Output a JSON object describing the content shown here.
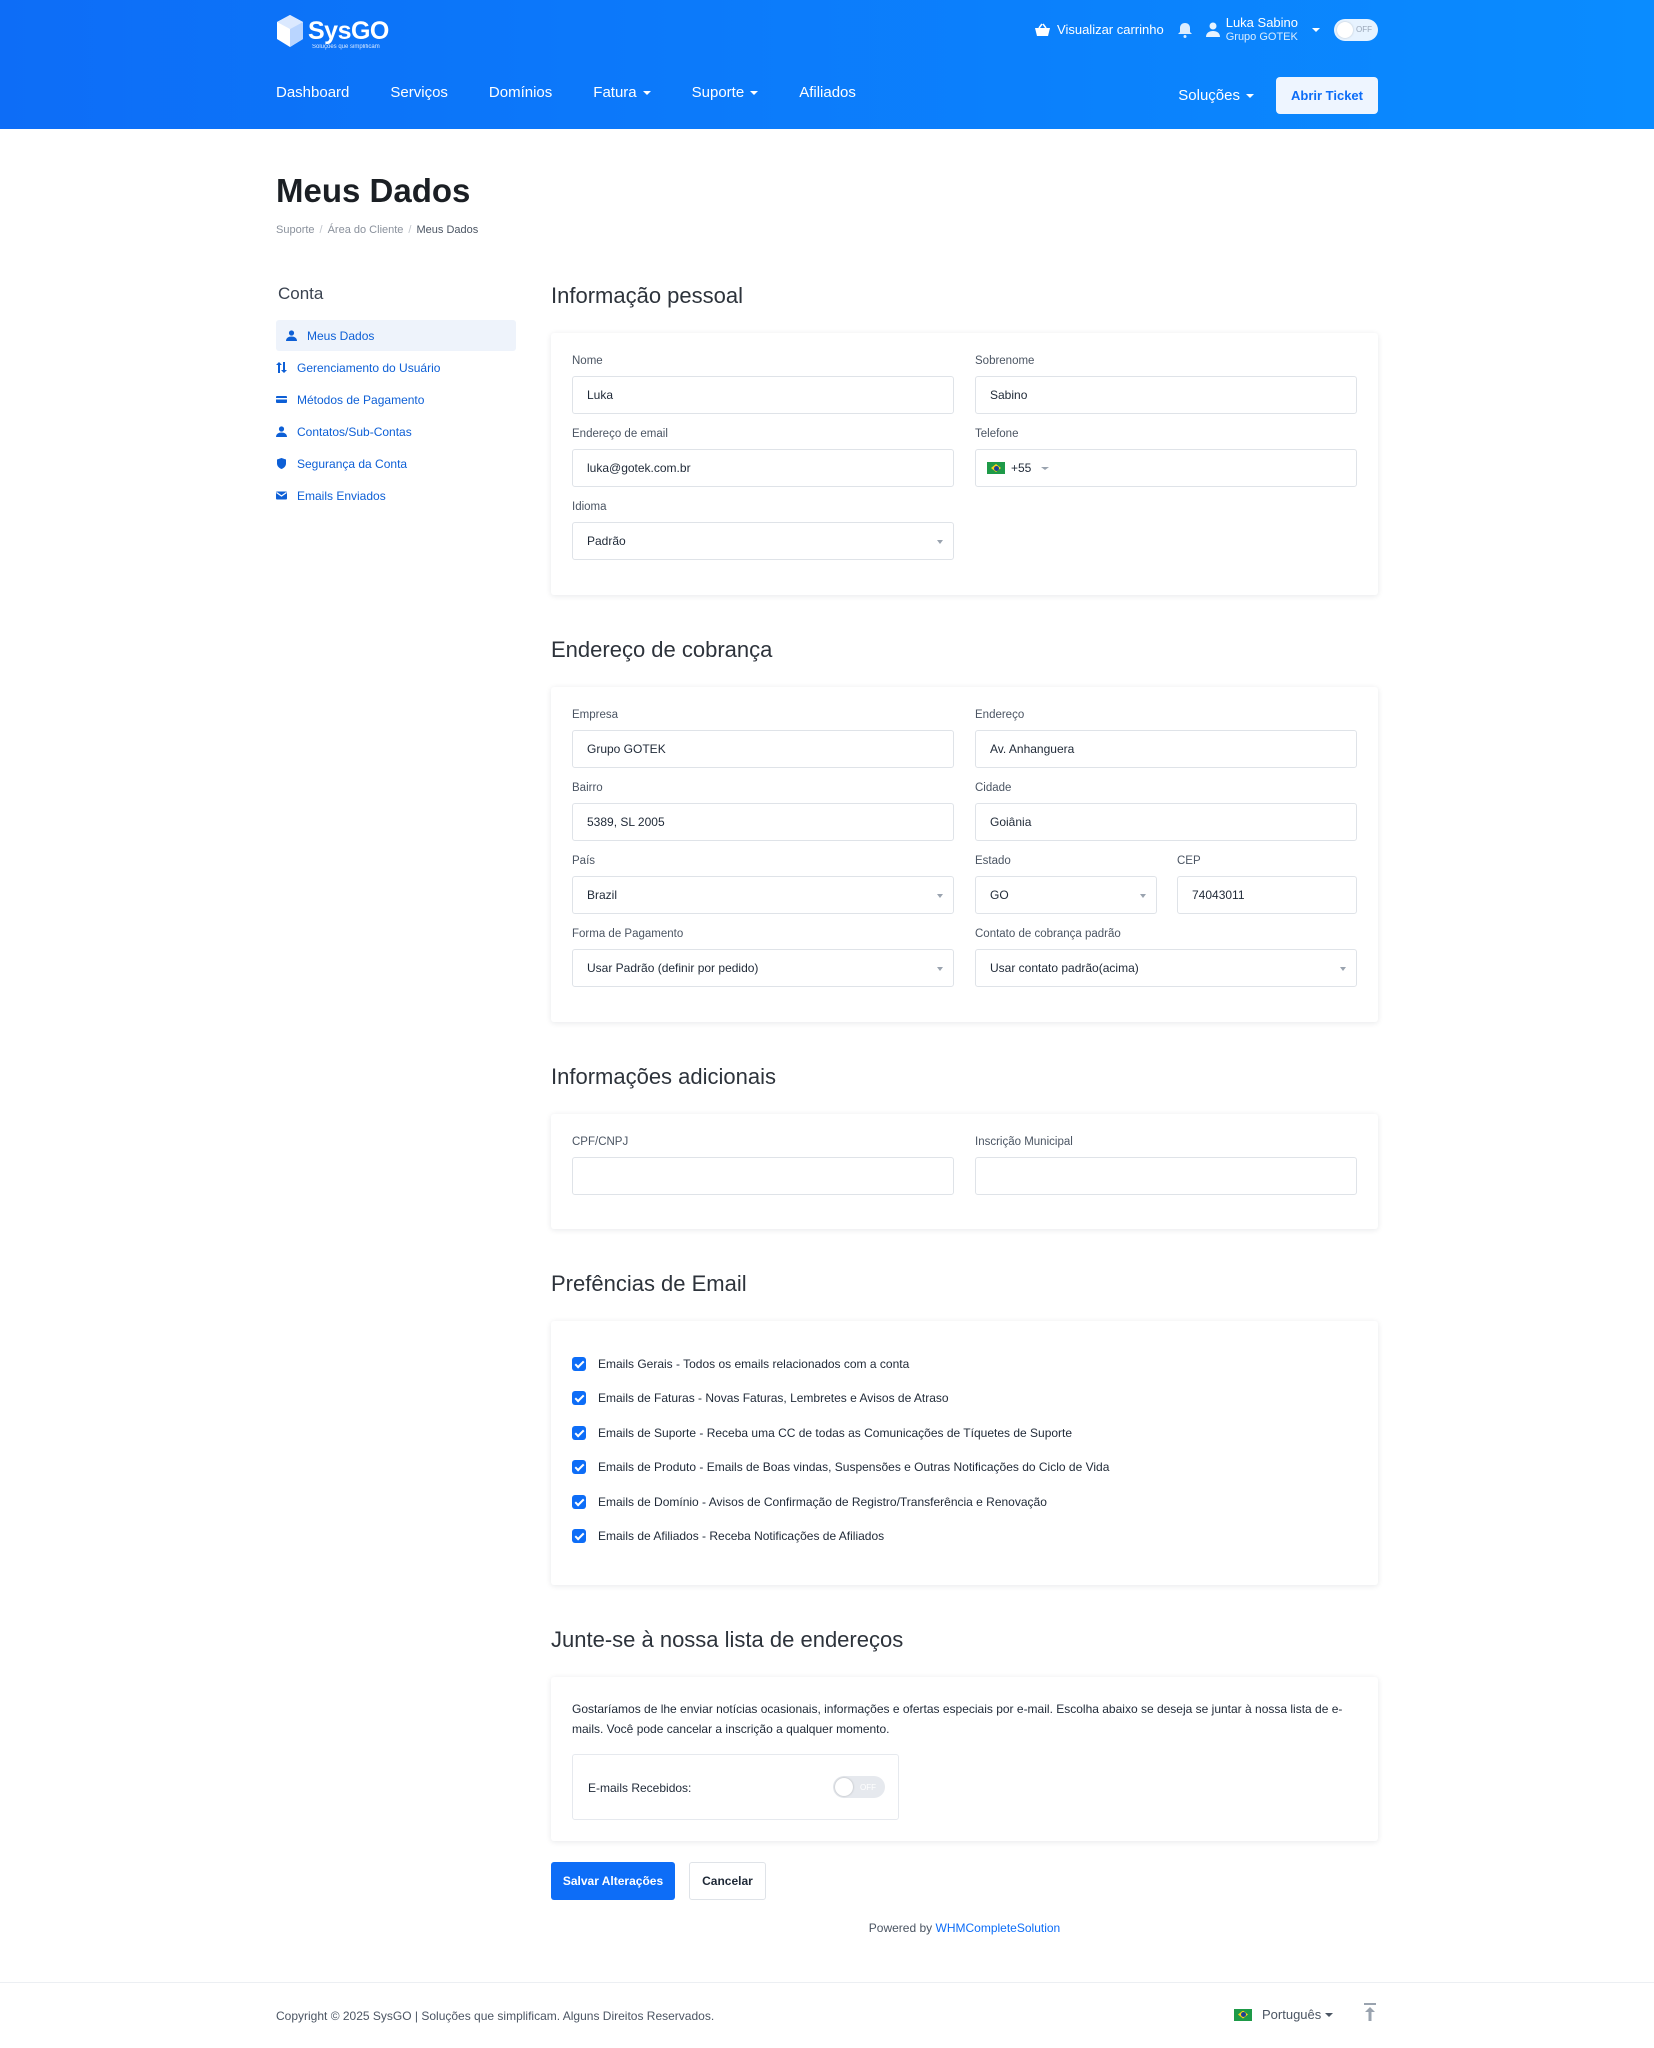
{
  "header": {
    "brand_name": "SysGO",
    "brand_tagline": "Soluções que simplificam",
    "cart_label": "Visualizar carrinho",
    "user_name": "Luka Sabino",
    "user_company": "Grupo GOTEK",
    "theme_toggle_label": "OFF",
    "nav": [
      "Dashboard",
      "Serviços",
      "Domínios",
      "Fatura",
      "Suporte",
      "Afiliados"
    ],
    "solutions_label": "Soluções",
    "ticket_button": "Abrir Ticket",
    "brand_color": "#0d6df7"
  },
  "page": {
    "title": "Meus Dados",
    "breadcrumb": [
      "Suporte",
      "Área do Cliente",
      "Meus Dados"
    ]
  },
  "sidebar": {
    "title": "Conta",
    "items": [
      {
        "label": "Meus Dados",
        "icon": "user-icon"
      },
      {
        "label": "Gerenciamento do Usuário",
        "icon": "arrows-icon"
      },
      {
        "label": "Métodos de Pagamento",
        "icon": "card-icon"
      },
      {
        "label": "Contatos/Sub-Contas",
        "icon": "user-icon"
      },
      {
        "label": "Segurança da Conta",
        "icon": "shield-icon"
      },
      {
        "label": "Emails Enviados",
        "icon": "envelope-icon"
      }
    ]
  },
  "personal": {
    "title": "Informação pessoal",
    "first_name_label": "Nome",
    "first_name": "Luka",
    "last_name_label": "Sobrenome",
    "last_name": "Sabino",
    "email_label": "Endereço de email",
    "email": "luka@gotek.com.br",
    "phone_label": "Telefone",
    "phone_code": "+55",
    "language_label": "Idioma",
    "language": "Padrão"
  },
  "billing": {
    "title": "Endereço de cobrança",
    "company_label": "Empresa",
    "company": "Grupo GOTEK",
    "address_label": "Endereço",
    "address": "Av. Anhanguera",
    "district_label": "Bairro",
    "district": "5389, SL 2005",
    "city_label": "Cidade",
    "city": "Goiânia",
    "country_label": "País",
    "country": "Brazil",
    "state_label": "Estado",
    "state": "GO",
    "zip_label": "CEP",
    "zip": "74043011",
    "payment_label": "Forma de Pagamento",
    "payment": "Usar Padrão (definir por pedido)",
    "contact_label": "Contato de cobrança padrão",
    "contact": "Usar contato padrão(acima)"
  },
  "additional": {
    "title": "Informações adicionais",
    "cpf_label": "CPF/CNPJ",
    "cpf": "",
    "municipal_label": "Inscrição Municipal",
    "municipal": ""
  },
  "email_prefs": {
    "title": "Prefências de Email",
    "items": [
      "Emails Gerais - Todos os emails relacionados com a conta",
      "Emails de Faturas - Novas Faturas, Lembretes e Avisos de Atraso",
      "Emails de Suporte - Receba uma CC de todas as Comunicações de Tíquetes de Suporte",
      "Emails de Produto - Emails de Boas vindas, Suspensões e Outras Notificações do Ciclo de Vida",
      "Emails de Domínio - Avisos de Confirmação de Registro/Transferência e Renovação",
      "Emails de Afiliados - Receba Notificações de Afiliados"
    ]
  },
  "mailing": {
    "title": "Junte-se à nossa lista de endereços",
    "text": "Gostaríamos de lhe enviar notícias ocasionais, informações e ofertas especiais por e-mail. Escolha abaixo se deseja se juntar à nossa lista de e-mails. Você pode cancelar a inscrição a qualquer momento.",
    "toggle_label": "E-mails Recebidos:",
    "toggle_state": "OFF"
  },
  "actions": {
    "save": "Salvar Alterações",
    "cancel": "Cancelar"
  },
  "footer": {
    "powered_prefix": "Powered by",
    "powered_link": "WHMCompleteSolution",
    "copyright": "Copyright © 2025 SysGO | Soluções que simplificam. Alguns Direitos Reservados.",
    "language": "Português"
  }
}
